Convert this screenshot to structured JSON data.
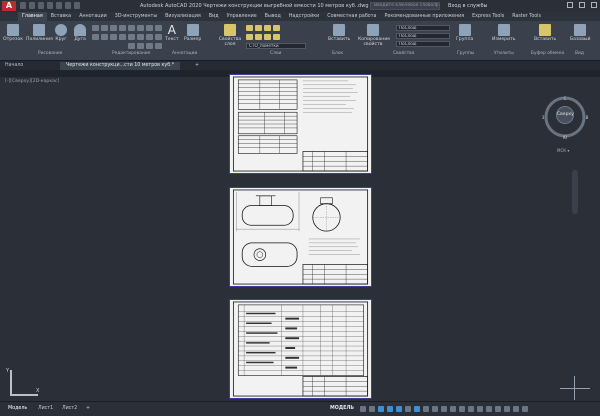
{
  "app": {
    "logo": "A",
    "title": "Autodesk AutoCAD 2020   Чертежи конструкции выгребной емкости 10 метров куб..dwg",
    "search_placeholder": "Введите ключевое слово/фразу",
    "sign_in": "Вход в службы"
  },
  "menu": {
    "items": [
      "Главная",
      "Вставка",
      "Аннотации",
      "3D-инструменты",
      "Визуализация",
      "Вид",
      "Управление",
      "Вывод",
      "Надстройки",
      "Совместная работа",
      "Рекомендованные приложения",
      "Express Tools",
      "Raster Tools"
    ],
    "active": 0
  },
  "ribbon": {
    "draw_tools": [
      "Отрезок",
      "Полилиния",
      "Круг",
      "Дуга"
    ],
    "panel_labels": [
      "Рисование",
      "Редактирование",
      "Аннотации",
      "Слои",
      "Блок",
      "Свойства",
      "Группы",
      "Утилиты",
      "Буфер обмена",
      "Вид"
    ],
    "annot_tools": [
      "Текст",
      "Размер"
    ],
    "layer_tool": "Свойства слоя",
    "block_tool": "Вставить",
    "prop_tool": "Копирование свойств",
    "group_tool": "Группа",
    "measure_tool": "Измерить",
    "paste_tool": "Вставить",
    "base_tool": "Базовый",
    "layer_select": "СТО_пометки",
    "prop_select1": "ПоСлою",
    "prop_select2": "ПоСлою",
    "prop_select3": "ПоСлою"
  },
  "file_tabs": {
    "start": "Начало",
    "drawing": "Чертежи конструкци...сти 10 метров куб.*",
    "plus": "+"
  },
  "viewport_label": "[-][Сверху][2D-каркас]",
  "viewcube": {
    "face": "Сверху",
    "mck": "МСК ▾",
    "n": "С",
    "s": "Ю",
    "w": "З",
    "e": "В"
  },
  "ucs": {
    "x": "X",
    "y": "Y"
  },
  "status": {
    "tabs": [
      "Модель",
      "Лист1",
      "Лист2"
    ],
    "model_label": "МОДЕЛЬ",
    "plus": "+"
  },
  "colors": {
    "accent": "#3b8fd6",
    "sheet_border": "#3c3f9c",
    "logo": "#c0282e"
  }
}
